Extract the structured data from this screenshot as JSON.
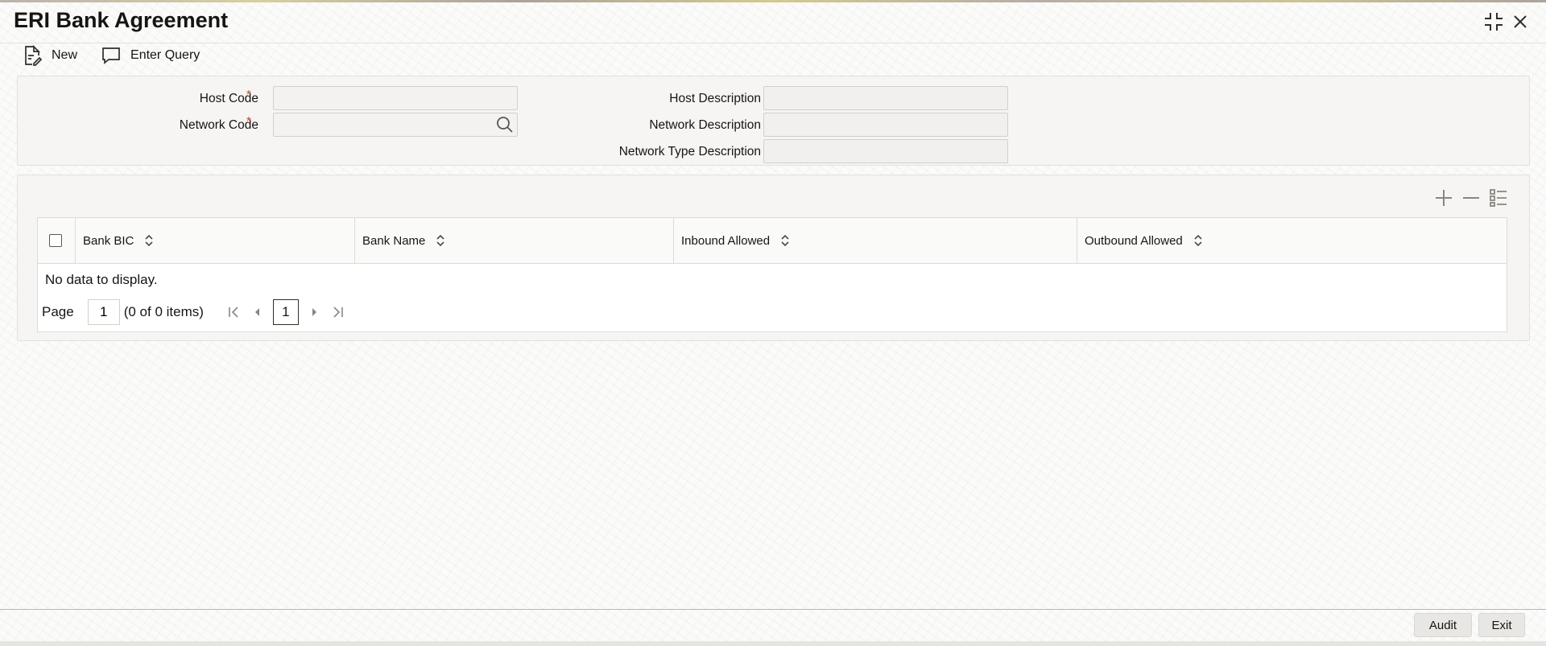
{
  "window": {
    "title": "ERI Bank Agreement",
    "maximize_icon": "collapse-icon",
    "close_icon": "close-icon"
  },
  "toolbar": {
    "new_label": "New",
    "enter_query_label": "Enter Query"
  },
  "form": {
    "host_code_label": "Host Code",
    "network_code_label": "Network Code",
    "host_description_label": "Host Description",
    "network_description_label": "Network Description",
    "network_type_description_label": "Network Type Description",
    "required_marker": "*",
    "host_code_value": "",
    "network_code_value": "",
    "host_description_value": "",
    "network_description_value": "",
    "network_type_description_value": ""
  },
  "table": {
    "columns": [
      "Bank BIC",
      "Bank Name",
      "Inbound Allowed",
      "Outbound Allowed"
    ],
    "rows": [],
    "empty_text": "No data to display."
  },
  "pagination": {
    "page_label": "Page",
    "page_value": "1",
    "items_text": "(0 of 0 items)",
    "current_page": "1"
  },
  "footer": {
    "audit_label": "Audit",
    "exit_label": "Exit"
  }
}
